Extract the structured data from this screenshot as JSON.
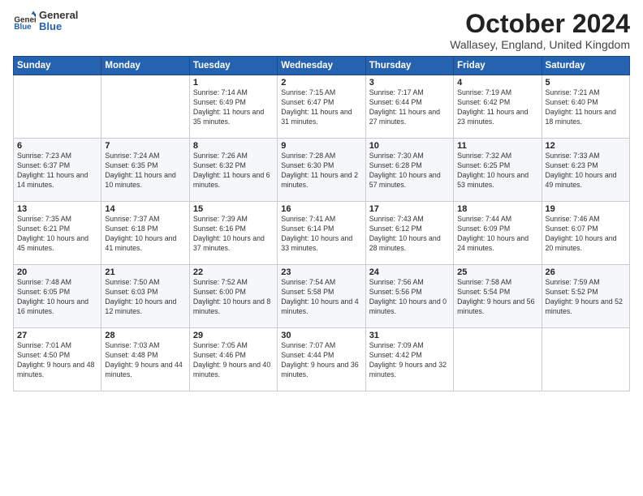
{
  "header": {
    "logo": {
      "general": "General",
      "blue": "Blue"
    },
    "title": "October 2024",
    "location": "Wallasey, England, United Kingdom"
  },
  "weekdays": [
    "Sunday",
    "Monday",
    "Tuesday",
    "Wednesday",
    "Thursday",
    "Friday",
    "Saturday"
  ],
  "weeks": [
    [
      {
        "day": "",
        "info": ""
      },
      {
        "day": "",
        "info": ""
      },
      {
        "day": "1",
        "info": "Sunrise: 7:14 AM\nSunset: 6:49 PM\nDaylight: 11 hours and 35 minutes."
      },
      {
        "day": "2",
        "info": "Sunrise: 7:15 AM\nSunset: 6:47 PM\nDaylight: 11 hours and 31 minutes."
      },
      {
        "day": "3",
        "info": "Sunrise: 7:17 AM\nSunset: 6:44 PM\nDaylight: 11 hours and 27 minutes."
      },
      {
        "day": "4",
        "info": "Sunrise: 7:19 AM\nSunset: 6:42 PM\nDaylight: 11 hours and 23 minutes."
      },
      {
        "day": "5",
        "info": "Sunrise: 7:21 AM\nSunset: 6:40 PM\nDaylight: 11 hours and 18 minutes."
      }
    ],
    [
      {
        "day": "6",
        "info": "Sunrise: 7:23 AM\nSunset: 6:37 PM\nDaylight: 11 hours and 14 minutes."
      },
      {
        "day": "7",
        "info": "Sunrise: 7:24 AM\nSunset: 6:35 PM\nDaylight: 11 hours and 10 minutes."
      },
      {
        "day": "8",
        "info": "Sunrise: 7:26 AM\nSunset: 6:32 PM\nDaylight: 11 hours and 6 minutes."
      },
      {
        "day": "9",
        "info": "Sunrise: 7:28 AM\nSunset: 6:30 PM\nDaylight: 11 hours and 2 minutes."
      },
      {
        "day": "10",
        "info": "Sunrise: 7:30 AM\nSunset: 6:28 PM\nDaylight: 10 hours and 57 minutes."
      },
      {
        "day": "11",
        "info": "Sunrise: 7:32 AM\nSunset: 6:25 PM\nDaylight: 10 hours and 53 minutes."
      },
      {
        "day": "12",
        "info": "Sunrise: 7:33 AM\nSunset: 6:23 PM\nDaylight: 10 hours and 49 minutes."
      }
    ],
    [
      {
        "day": "13",
        "info": "Sunrise: 7:35 AM\nSunset: 6:21 PM\nDaylight: 10 hours and 45 minutes."
      },
      {
        "day": "14",
        "info": "Sunrise: 7:37 AM\nSunset: 6:18 PM\nDaylight: 10 hours and 41 minutes."
      },
      {
        "day": "15",
        "info": "Sunrise: 7:39 AM\nSunset: 6:16 PM\nDaylight: 10 hours and 37 minutes."
      },
      {
        "day": "16",
        "info": "Sunrise: 7:41 AM\nSunset: 6:14 PM\nDaylight: 10 hours and 33 minutes."
      },
      {
        "day": "17",
        "info": "Sunrise: 7:43 AM\nSunset: 6:12 PM\nDaylight: 10 hours and 28 minutes."
      },
      {
        "day": "18",
        "info": "Sunrise: 7:44 AM\nSunset: 6:09 PM\nDaylight: 10 hours and 24 minutes."
      },
      {
        "day": "19",
        "info": "Sunrise: 7:46 AM\nSunset: 6:07 PM\nDaylight: 10 hours and 20 minutes."
      }
    ],
    [
      {
        "day": "20",
        "info": "Sunrise: 7:48 AM\nSunset: 6:05 PM\nDaylight: 10 hours and 16 minutes."
      },
      {
        "day": "21",
        "info": "Sunrise: 7:50 AM\nSunset: 6:03 PM\nDaylight: 10 hours and 12 minutes."
      },
      {
        "day": "22",
        "info": "Sunrise: 7:52 AM\nSunset: 6:00 PM\nDaylight: 10 hours and 8 minutes."
      },
      {
        "day": "23",
        "info": "Sunrise: 7:54 AM\nSunset: 5:58 PM\nDaylight: 10 hours and 4 minutes."
      },
      {
        "day": "24",
        "info": "Sunrise: 7:56 AM\nSunset: 5:56 PM\nDaylight: 10 hours and 0 minutes."
      },
      {
        "day": "25",
        "info": "Sunrise: 7:58 AM\nSunset: 5:54 PM\nDaylight: 9 hours and 56 minutes."
      },
      {
        "day": "26",
        "info": "Sunrise: 7:59 AM\nSunset: 5:52 PM\nDaylight: 9 hours and 52 minutes."
      }
    ],
    [
      {
        "day": "27",
        "info": "Sunrise: 7:01 AM\nSunset: 4:50 PM\nDaylight: 9 hours and 48 minutes."
      },
      {
        "day": "28",
        "info": "Sunrise: 7:03 AM\nSunset: 4:48 PM\nDaylight: 9 hours and 44 minutes."
      },
      {
        "day": "29",
        "info": "Sunrise: 7:05 AM\nSunset: 4:46 PM\nDaylight: 9 hours and 40 minutes."
      },
      {
        "day": "30",
        "info": "Sunrise: 7:07 AM\nSunset: 4:44 PM\nDaylight: 9 hours and 36 minutes."
      },
      {
        "day": "31",
        "info": "Sunrise: 7:09 AM\nSunset: 4:42 PM\nDaylight: 9 hours and 32 minutes."
      },
      {
        "day": "",
        "info": ""
      },
      {
        "day": "",
        "info": ""
      }
    ]
  ]
}
